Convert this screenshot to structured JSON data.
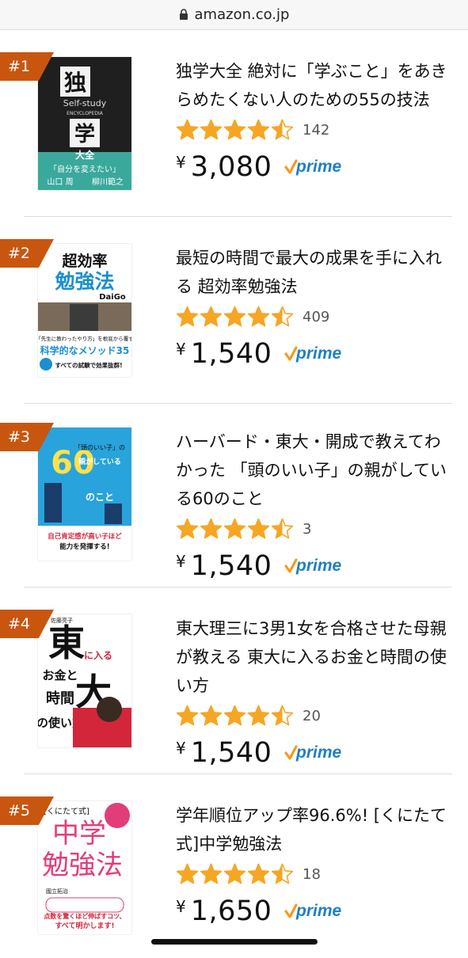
{
  "url": "amazon.co.jp",
  "colors": {
    "rank_badge": "#c9560f",
    "star": "#f6a623",
    "prime_check": "#f49b1f",
    "prime_text": "#1f7fc6"
  },
  "prime_label": "prime",
  "currency": "¥",
  "products": [
    {
      "rank": "#1",
      "title": "独学大全 絶対に「学ぶこと」をあきらめたくない人のための55の技法",
      "rating": 4.5,
      "review_count": "142",
      "price": "3,080",
      "cover": {
        "bg": "#1f1f1f",
        "accent": "#3aa99b",
        "lines": [
          "独",
          "Self-study",
          "ENCYCLOPEDIA",
          "学",
          "大全",
          "「自分を変えたい」",
          "山口 周",
          "柳川範之"
        ]
      }
    },
    {
      "rank": "#2",
      "title": "最短の時間で最大の成果を手に入れる 超効率勉強法",
      "rating": 4.5,
      "review_count": "409",
      "price": "1,540",
      "cover": {
        "bg": "#ffffff",
        "accent": "#1b8fd0",
        "lines": [
          "超効率",
          "勉強法",
          "DaiGo",
          "「先生に教わったやり方」を根底から覆す",
          "科学的なメソッド35",
          "すべての試験で効果抜群!"
        ]
      }
    },
    {
      "rank": "#3",
      "title": "ハーバード・東大・開成で教えてわかった 「頭のいい子」の親がしている60のこと",
      "rating": 4.5,
      "review_count": "3",
      "price": "1,540",
      "cover": {
        "bg": "#29a3dc",
        "accent": "#ffe14a",
        "lines": [
          "60",
          "「頭のいい子」の",
          "親がしている",
          "のこと",
          "自己肯定感が高い子ほど",
          "能力を発揮する!"
        ]
      }
    },
    {
      "rank": "#4",
      "title": "東大理三に3男1女を合格させた母親が教える 東大に入るお金と時間の使い方",
      "rating": 4.5,
      "review_count": "20",
      "price": "1,540",
      "cover": {
        "bg": "#ffffff",
        "accent": "#d3263a",
        "lines": [
          "東",
          "大",
          "に入る",
          "お金と",
          "時間",
          "の使い方",
          "佐藤亮子"
        ]
      }
    },
    {
      "rank": "#5",
      "title": "学年順位アップ率96.6%! [くにたて式]中学勉強法",
      "rating": 4.5,
      "review_count": "18",
      "price": "1,650",
      "cover": {
        "bg": "#ffffff",
        "accent": "#e23d7b",
        "lines": [
          "[くにたて式]",
          "中学",
          "勉強法",
          "國立拓治",
          "点数を驚くほど伸ばすコツ、",
          "すべて明かします!"
        ]
      }
    }
  ]
}
